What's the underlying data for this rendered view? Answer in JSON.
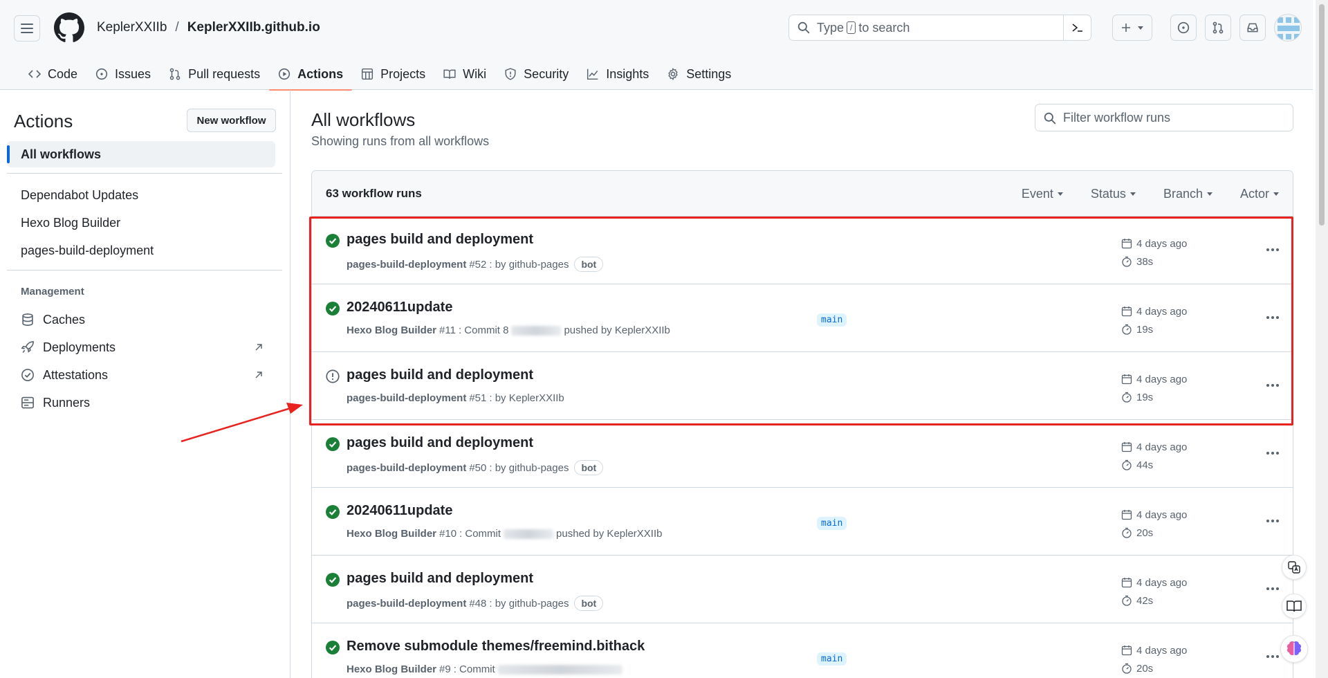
{
  "header": {
    "owner": "KeplerXXIIb",
    "separator": "/",
    "repo": "KeplerXXIIb.github.io",
    "search": {
      "prefix": "Type",
      "key": "/",
      "suffix": "to search"
    }
  },
  "tabs": [
    {
      "label": "Code"
    },
    {
      "label": "Issues"
    },
    {
      "label": "Pull requests"
    },
    {
      "label": "Actions"
    },
    {
      "label": "Projects"
    },
    {
      "label": "Wiki"
    },
    {
      "label": "Security"
    },
    {
      "label": "Insights"
    },
    {
      "label": "Settings"
    }
  ],
  "sidebar": {
    "title": "Actions",
    "new_workflow": "New workflow",
    "all_workflows": "All workflows",
    "workflows": [
      "Dependabot Updates",
      "Hexo Blog Builder",
      "pages-build-deployment"
    ],
    "management_heading": "Management",
    "management": [
      "Caches",
      "Deployments",
      "Attestations",
      "Runners"
    ]
  },
  "main": {
    "title": "All workflows",
    "subtitle": "Showing runs from all workflows",
    "filter_placeholder": "Filter workflow runs",
    "run_count": "63 workflow runs",
    "filters": [
      "Event",
      "Status",
      "Branch",
      "Actor"
    ]
  },
  "runs": [
    {
      "title": "pages build and deployment",
      "workflow": "pages-build-deployment",
      "number": "#52",
      "by": ": by github-pages",
      "badge": "bot",
      "branch": "",
      "when": "4 days ago",
      "duration": "38s",
      "status": "success"
    },
    {
      "title": "20240611update",
      "workflow": "Hexo Blog Builder",
      "number": "#11",
      "by_prefix": ": Commit 8",
      "by_suffix": "pushed by KeplerXXIIb",
      "branch": "main",
      "when": "4 days ago",
      "duration": "19s",
      "status": "success"
    },
    {
      "title": "pages build and deployment",
      "workflow": "pages-build-deployment",
      "number": "#51",
      "by": ": by KeplerXXIIb",
      "branch": "",
      "when": "4 days ago",
      "duration": "19s",
      "status": "failure"
    },
    {
      "title": "pages build and deployment",
      "workflow": "pages-build-deployment",
      "number": "#50",
      "by": ": by github-pages",
      "badge": "bot",
      "branch": "",
      "when": "4 days ago",
      "duration": "44s",
      "status": "success"
    },
    {
      "title": "20240611update",
      "workflow": "Hexo Blog Builder",
      "number": "#10",
      "by_prefix": ": Commit",
      "by_suffix": "pushed by KeplerXXIIb",
      "branch": "main",
      "when": "4 days ago",
      "duration": "20s",
      "status": "success"
    },
    {
      "title": "pages build and deployment",
      "workflow": "pages-build-deployment",
      "number": "#48",
      "by": ": by github-pages",
      "badge": "bot",
      "branch": "",
      "when": "4 days ago",
      "duration": "42s",
      "status": "success"
    },
    {
      "title": "Remove submodule themes/freemind.bithack",
      "workflow": "Hexo Blog Builder",
      "number": "#9",
      "by_prefix": ": Commit",
      "by_suffix": "",
      "branch": "main",
      "when": "4 days ago",
      "duration": "20s",
      "status": "success"
    }
  ],
  "colors": {
    "accent": "#0969da",
    "success": "#1a7f37",
    "underline": "#fd8c73",
    "annotation": "#e8221f"
  }
}
